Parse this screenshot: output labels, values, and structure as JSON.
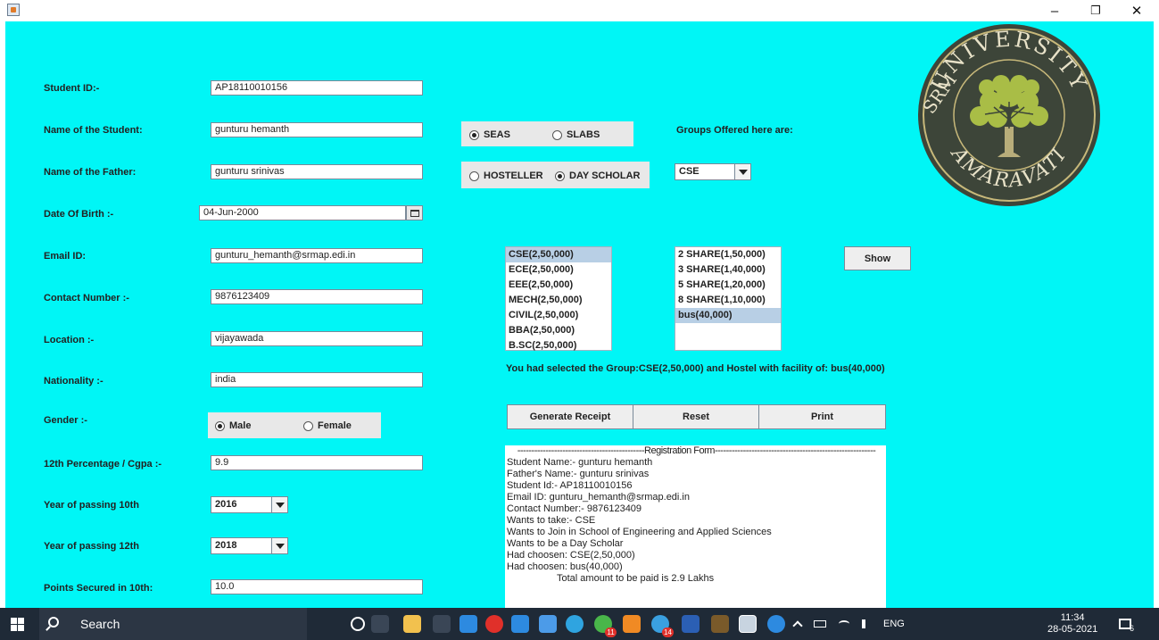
{
  "window": {
    "controls": {
      "minimize": "–",
      "maximize": "❐",
      "close": "✕"
    }
  },
  "form": {
    "student_id": {
      "label": "Student ID:-",
      "value": "AP18110010156"
    },
    "student_name": {
      "label": "Name of the Student:",
      "value": "gunturu hemanth"
    },
    "father_name": {
      "label": "Name of the Father:",
      "value": "gunturu srinivas"
    },
    "dob": {
      "label": "Date Of Birth :-",
      "value": "04-Jun-2000"
    },
    "email": {
      "label": "Email ID:",
      "value": "gunturu_hemanth@srmap.edi.in"
    },
    "contact": {
      "label": "Contact Number :-",
      "value": "9876123409"
    },
    "location": {
      "label": "Location :-",
      "value": "vijayawada"
    },
    "nationality": {
      "label": "Nationality :-",
      "value": "india"
    },
    "gender": {
      "label": "Gender :-",
      "options": [
        "Male",
        "Female"
      ],
      "selected": "Male"
    },
    "percentage": {
      "label": "12th Percentage / Cgpa :-",
      "value": "9.9"
    },
    "year10": {
      "label": "Year of passing 10th",
      "value": "2016"
    },
    "year12": {
      "label": "Year of passing 12th",
      "value": "2018"
    },
    "points10": {
      "label": "Points Secured in 10th:",
      "value": "10.0"
    }
  },
  "school": {
    "options": [
      "SEAS",
      "SLABS"
    ],
    "selected": "SEAS"
  },
  "residence": {
    "options": [
      "HOSTELLER",
      "DAY SCHOLAR"
    ],
    "selected": "DAY SCHOLAR"
  },
  "groups": {
    "label": "Groups Offered here are:",
    "selected": "CSE"
  },
  "group_list": {
    "items": [
      "CSE(2,50,000)",
      "ECE(2,50,000)",
      "EEE(2,50,000)",
      "MECH(2,50,000)",
      "CIVIL(2,50,000)",
      "BBA(2,50,000)",
      "B.SC(2,50,000)"
    ],
    "selected_index": 0
  },
  "facility_list": {
    "items": [
      "2 SHARE(1,50,000)",
      "3 SHARE(1,40,000)",
      "5 SHARE(1,20,000)",
      "8 SHARE(1,10,000)",
      "bus(40,000)"
    ],
    "selected_index": 4
  },
  "buttons": {
    "show": "Show",
    "generate": "Generate Receipt",
    "reset": "Reset",
    "print": "Print"
  },
  "selection_message": "You had selected the Group:CSE(2,50,000) and Hostel with facility of: bus(40,000)",
  "receipt": {
    "header": "---------------------------------------------Registration Form---------------------------------------------------------",
    "lines": [
      "Student Name:- gunturu hemanth",
      "Father's Name:- gunturu srinivas",
      "Student Id:- AP18110010156",
      "Email ID: gunturu_hemanth@srmap.edi.in",
      "Contact Number:- 9876123409",
      "Wants to take:- CSE",
      "Wants to Join in School of Engineering and Applied Sciences",
      "Wants to be a Day Scholar",
      "Had choosen: CSE(2,50,000)",
      "Had choosen: bus(40,000)"
    ],
    "total": "Total amount to be paid is 2.9 Lakhs"
  },
  "logo": {
    "top_text": "UNIVERSITY",
    "left_text": "SRM",
    "bottom_text": "AMARAVATI"
  },
  "taskbar": {
    "search_placeholder": "Search",
    "language": "ENG",
    "time": "11:34",
    "date": "28-05-2021",
    "notifications": "6",
    "badge_a": "11",
    "badge_b": "14"
  }
}
